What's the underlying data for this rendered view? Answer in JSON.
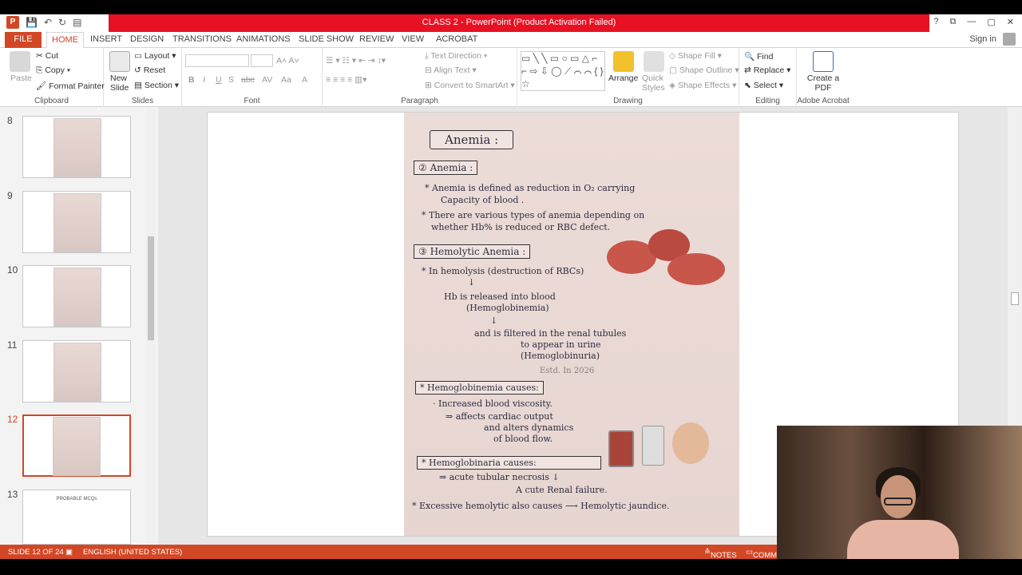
{
  "window": {
    "title": "CLASS 2 -  PowerPoint (Product Activation Failed)",
    "signin": "Sign in",
    "controls": [
      "?",
      "⧉",
      "—",
      "▢",
      "✕"
    ]
  },
  "tabs": [
    "FILE",
    "HOME",
    "INSERT",
    "DESIGN",
    "TRANSITIONS",
    "ANIMATIONS",
    "SLIDE SHOW",
    "REVIEW",
    "VIEW",
    "ACROBAT"
  ],
  "ribbon": {
    "clipboard": {
      "paste": "Paste",
      "cut": "Cut",
      "copy": "Copy",
      "format_painter": "Format Painter",
      "label": "Clipboard"
    },
    "slides": {
      "new_slide": "New Slide",
      "layout": "Layout",
      "reset": "Reset",
      "section": "Section",
      "label": "Slides"
    },
    "font": {
      "label": "Font",
      "bold": "B",
      "italic": "I",
      "underline": "U",
      "shadow": "S",
      "strike": "abc",
      "spacing": "AV",
      "case": "Aa",
      "color": "A"
    },
    "paragraph": {
      "text_direction": "Text Direction",
      "align_text": "Align Text",
      "smartart": "Convert to SmartArt",
      "label": "Paragraph"
    },
    "drawing": {
      "arrange": "Arrange",
      "quick_styles": "Quick Styles",
      "shape_fill": "Shape Fill",
      "shape_outline": "Shape Outline",
      "shape_effects": "Shape Effects",
      "label": "Drawing"
    },
    "editing": {
      "find": "Find",
      "replace": "Replace",
      "select": "Select",
      "label": "Editing"
    },
    "acrobat": {
      "create_pdf": "Create a PDF",
      "label": "Adobe Acrobat"
    }
  },
  "thumbnails": [
    {
      "num": "8"
    },
    {
      "num": "9"
    },
    {
      "num": "10"
    },
    {
      "num": "11"
    },
    {
      "num": "12"
    },
    {
      "num": "13",
      "caption": "PROBABLE MCQs"
    }
  ],
  "slide": {
    "title": "Anemia :",
    "s2_heading": "② Anemia :",
    "s2_b1a": "* Anemia is defined as reduction in O₂ carrying",
    "s2_b1b": "Capacity of blood .",
    "s2_b2a": "* There are various types of anemia depending on",
    "s2_b2b": "whether Hb% is reduced or RBC defect.",
    "s3_heading": "③ Hemolytic Anemia :",
    "s3_b1": "* In hemolysis (destruction of RBCs)",
    "s3_arrow1": "↓",
    "s3_l1": "Hb is released into blood",
    "s3_l2": "(Hemoglobinemia)",
    "s3_arrow2": "↓",
    "s3_l3": "and is filtered in the renal tubules",
    "s3_l4": "to appear in urine",
    "s3_l5": "(Hemoglobinuria)",
    "estd": "Estd. In 2026",
    "hb_heading": "* Hemoglobinemia causes:",
    "hb_l1": "· Increased blood viscosity.",
    "hb_l2": "⇒ affects cardiac output",
    "hb_l3": "and alters dynamics",
    "hb_l4": "of blood flow.",
    "hu_heading": "* Hemoglobinaria causes:",
    "hu_l1": "⇒ acute tubular necrosis ↓",
    "hu_l2": "A cute Renal failure.",
    "last": "* Excessive hemolytic also causes ⟶ Hemolytic jaundice."
  },
  "status": {
    "slide": "SLIDE 12 OF 24",
    "lang": "ENGLISH (UNITED STATES)",
    "notes": "NOTES",
    "comments": "COMM"
  },
  "colors": {
    "accent": "#d24726",
    "title_red": "#e81123"
  }
}
